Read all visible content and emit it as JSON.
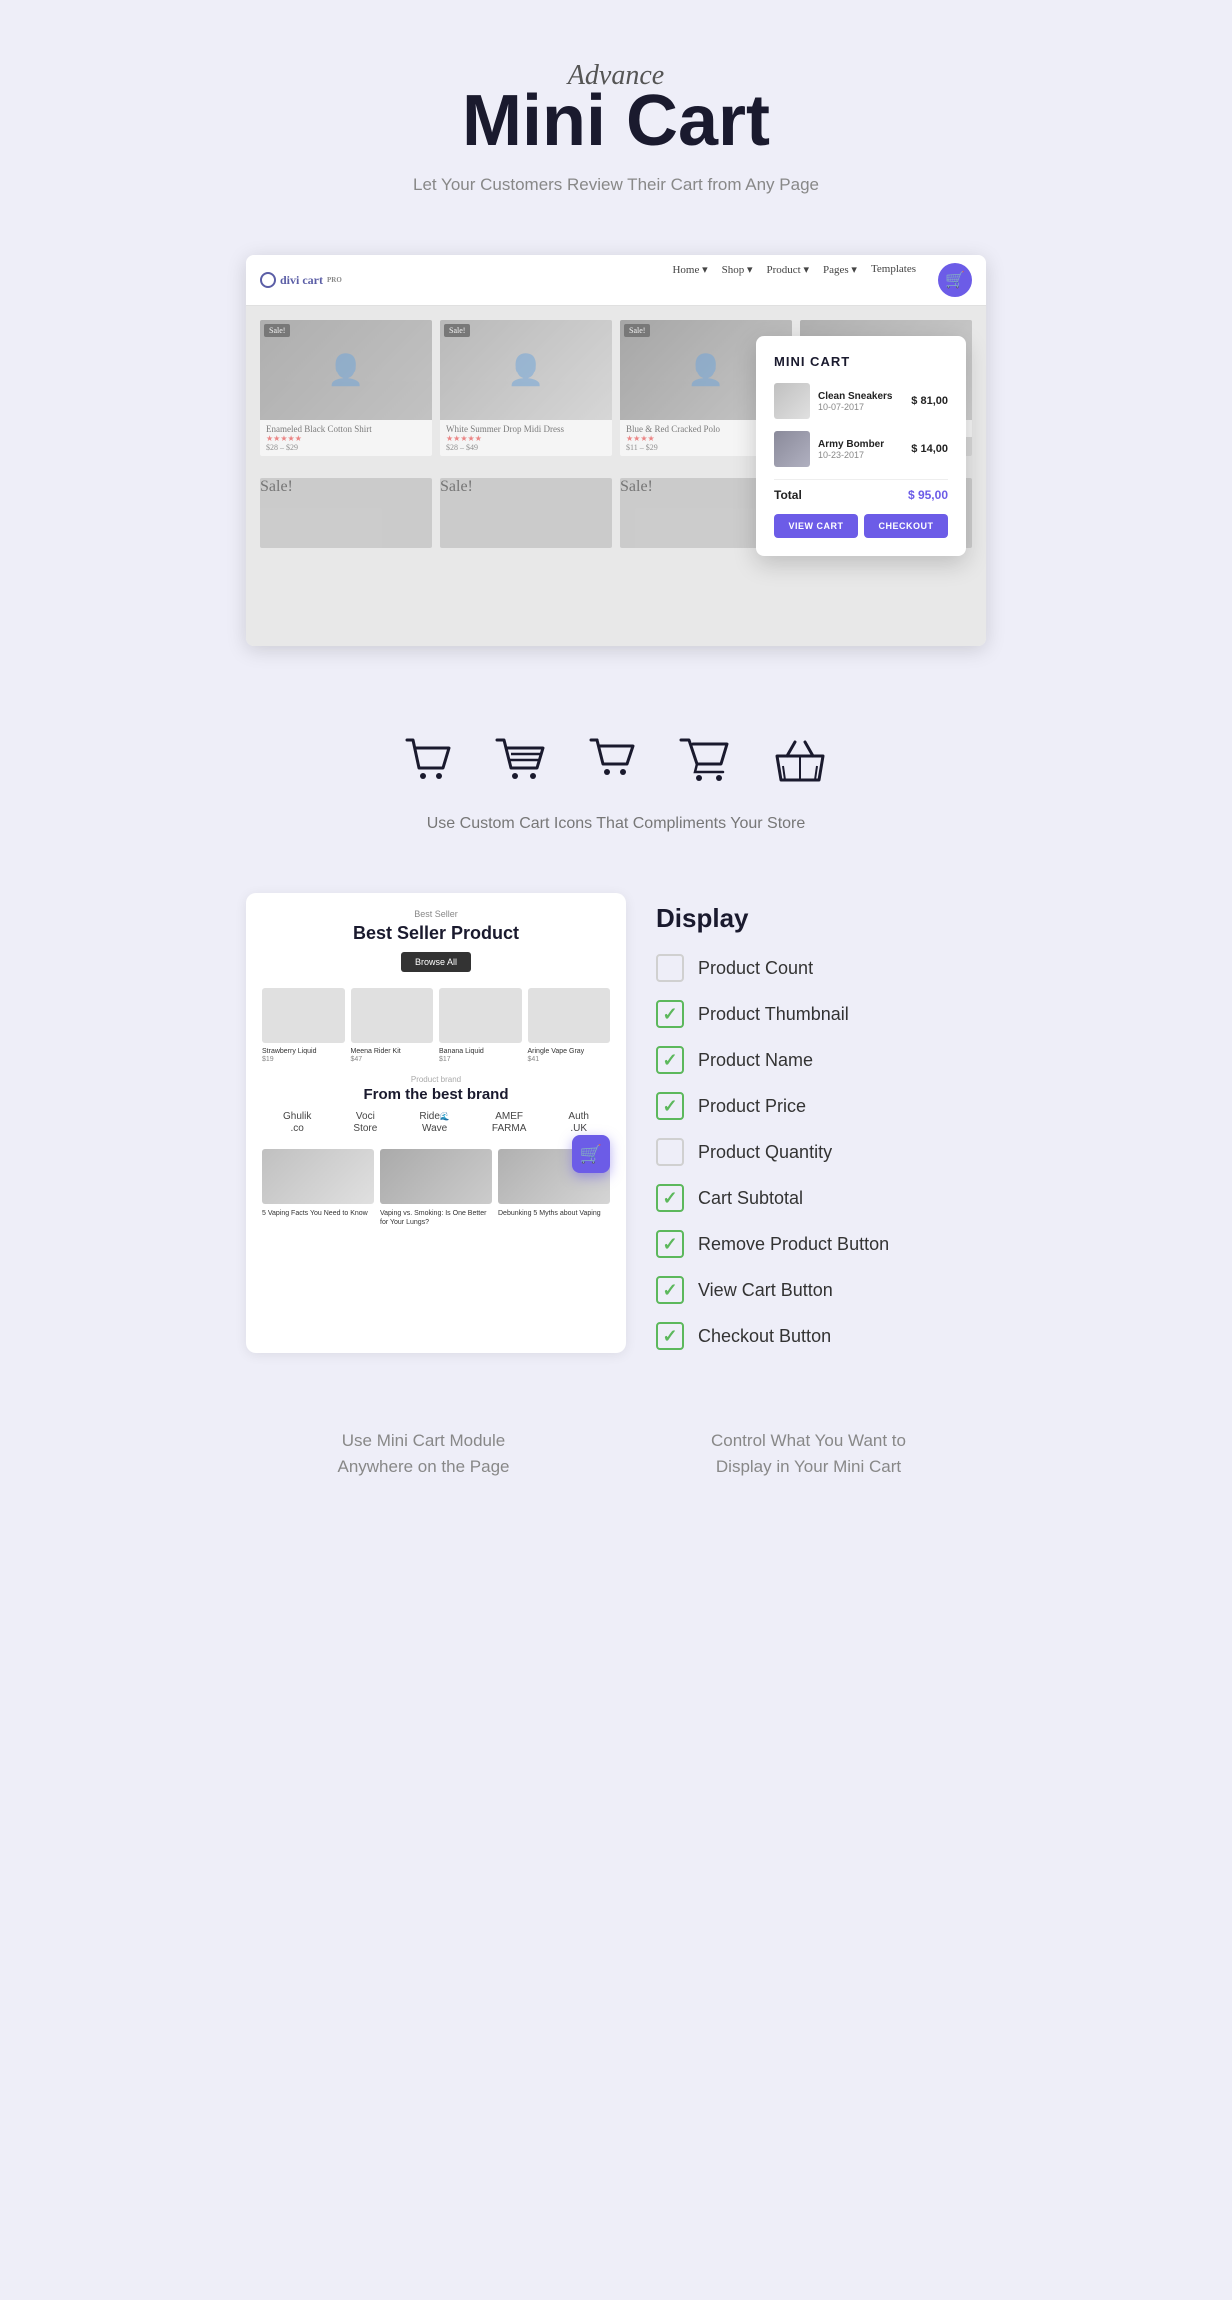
{
  "hero": {
    "advance_label": "Advance",
    "title": "Mini Cart",
    "subtitle": "Let Your Customers Review Their Cart from Any Page"
  },
  "browser": {
    "logo": "divi cart",
    "nav_items": [
      "Home",
      "Shop",
      "Product",
      "Pages",
      "Templates"
    ],
    "cart_icon": "🛒"
  },
  "mini_cart": {
    "title": "MINI CART",
    "items": [
      {
        "name": "Clean Sneakers",
        "date": "10-07-2017",
        "price": "$ 81,00"
      },
      {
        "name": "Army Bomber",
        "date": "10-23-2017",
        "price": "$ 14,00"
      }
    ],
    "total_label": "Total",
    "total_price": "$ 95,00",
    "view_cart_label": "VIEW CART",
    "checkout_label": "CHECKOUT"
  },
  "products_demo": [
    {
      "name": "Enameled Black Cotton Shirt",
      "sale": true
    },
    {
      "name": "White Summer Drop Midi Dress",
      "sale": true
    },
    {
      "name": "Blue & Red Cracked Polo",
      "sale": true
    },
    {
      "name": "",
      "sale": false
    }
  ],
  "icons_section": {
    "label": "Use Custom Cart Icons That Compliments Your Store",
    "icons": [
      "cart1",
      "cart2",
      "cart3",
      "cart4",
      "basket"
    ]
  },
  "best_seller": {
    "tag": "Best Seller",
    "title": "Best Seller Product",
    "browse_btn": "Browse All",
    "products": [
      {
        "name": "Strawberry Liquid",
        "price": "$19"
      },
      {
        "name": "Meena Rider Kit",
        "price": "$47"
      },
      {
        "name": "Banana Liquid",
        "price": "$17"
      },
      {
        "name": "Aringle Vape Gray",
        "price": "$41"
      }
    ],
    "brand_tag": "Product brand",
    "brand_title": "From the best brand",
    "brands": [
      "Ghulik .co",
      "Voci Store",
      "Ride Wave",
      "AMEF FARMA",
      "Auth .UK"
    ],
    "blog_posts": [
      {
        "title": "5 Vaping Facts You Need to Know"
      },
      {
        "title": "Vaping vs. Smoking: Is One Better for Your Lungs?"
      },
      {
        "title": "Debunking 5 Myths about Vaping"
      }
    ]
  },
  "display": {
    "heading": "Display",
    "items": [
      {
        "label": "Product Count",
        "checked": false
      },
      {
        "label": "Product Thumbnail",
        "checked": true
      },
      {
        "label": "Product Name",
        "checked": true
      },
      {
        "label": "Product Price",
        "checked": true
      },
      {
        "label": "Product Quantity",
        "checked": false
      },
      {
        "label": "Cart Subtotal",
        "checked": true
      },
      {
        "label": "Remove Product Button",
        "checked": true
      },
      {
        "label": "View Cart Button",
        "checked": true
      },
      {
        "label": "Checkout Button",
        "checked": true
      }
    ]
  },
  "captions": {
    "left": "Use Mini Cart Module\nAnywhere on the Page",
    "right": "Control What You Want to\nDisplay in Your Mini Cart"
  }
}
